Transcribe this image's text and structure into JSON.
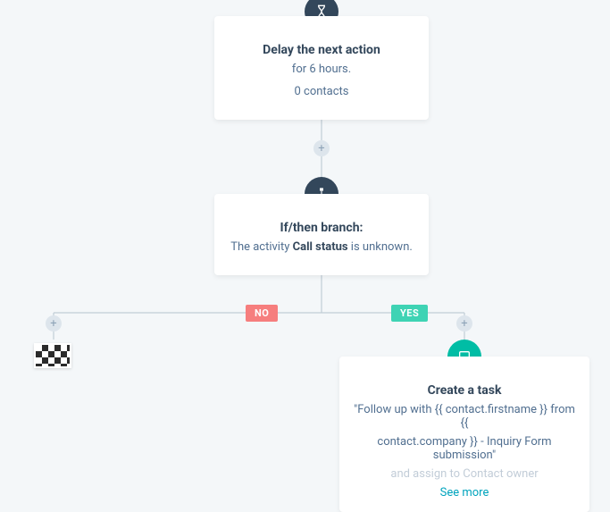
{
  "delay": {
    "title": "Delay the next action",
    "duration": "for 6 hours.",
    "contacts": "0 contacts"
  },
  "branch": {
    "title": "If/then branch:",
    "activity_prefix": "The activity ",
    "activity_bold": "Call status",
    "activity_suffix": " is unknown."
  },
  "labels": {
    "no": "NO",
    "yes": "YES"
  },
  "task": {
    "title": "Create a task",
    "body1": "\"Follow up with {{ contact.firstname }} from {{",
    "body2": "contact.company }} - Inquiry Form submission\"",
    "body3": "and assign to Contact owner",
    "see_more": "See more"
  }
}
